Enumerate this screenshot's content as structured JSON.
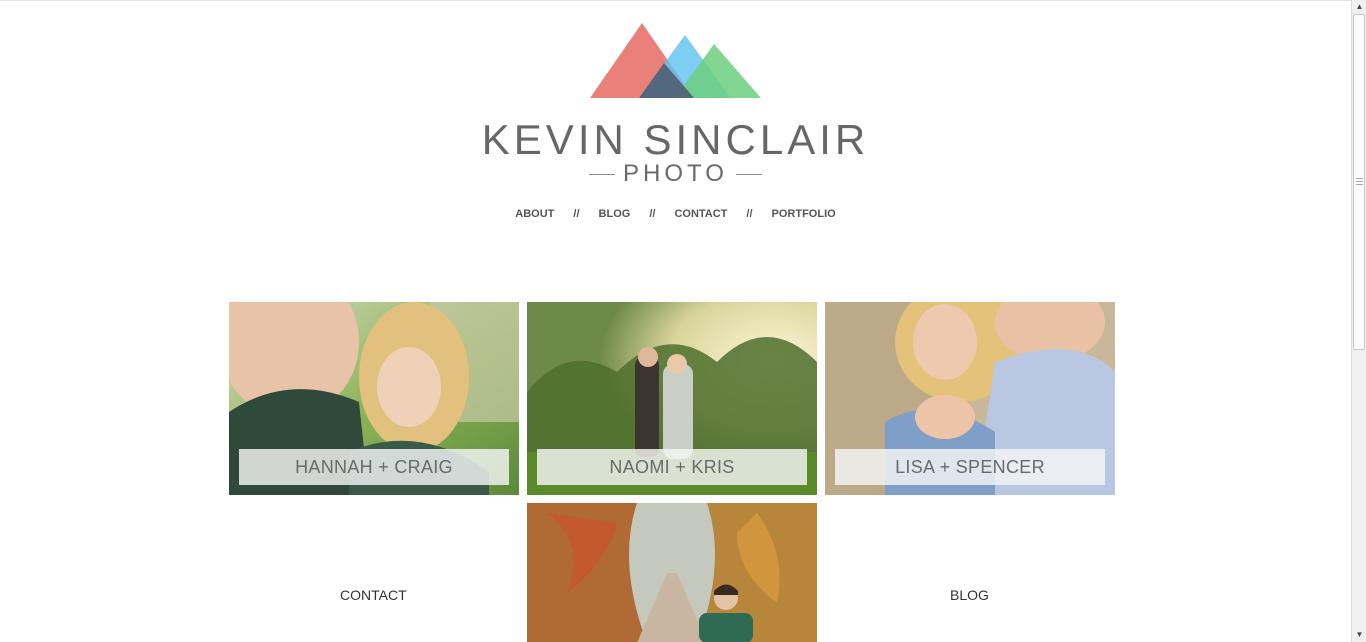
{
  "brand": {
    "name": "KEVIN SINCLAIR",
    "sub": "PHOTO"
  },
  "nav": {
    "items": [
      {
        "label": "ABOUT"
      },
      {
        "label": "BLOG"
      },
      {
        "label": "CONTACT"
      },
      {
        "label": "PORTFOLIO"
      }
    ],
    "separator": "//"
  },
  "gallery": {
    "tiles": [
      {
        "label": "HANNAH + CRAIG"
      },
      {
        "label": "NAOMI + KRIS"
      },
      {
        "label": "LISA + SPENCER"
      }
    ]
  },
  "links": {
    "contact": "CONTACT",
    "blog": "BLOG"
  },
  "colors": {
    "logo_red": "#e8726b",
    "logo_blue": "#5ec1f0",
    "logo_green": "#6ccf7e",
    "text": "#676767"
  },
  "icons": {
    "scroll_up": "triangle-up",
    "scroll_down": "triangle-down"
  }
}
